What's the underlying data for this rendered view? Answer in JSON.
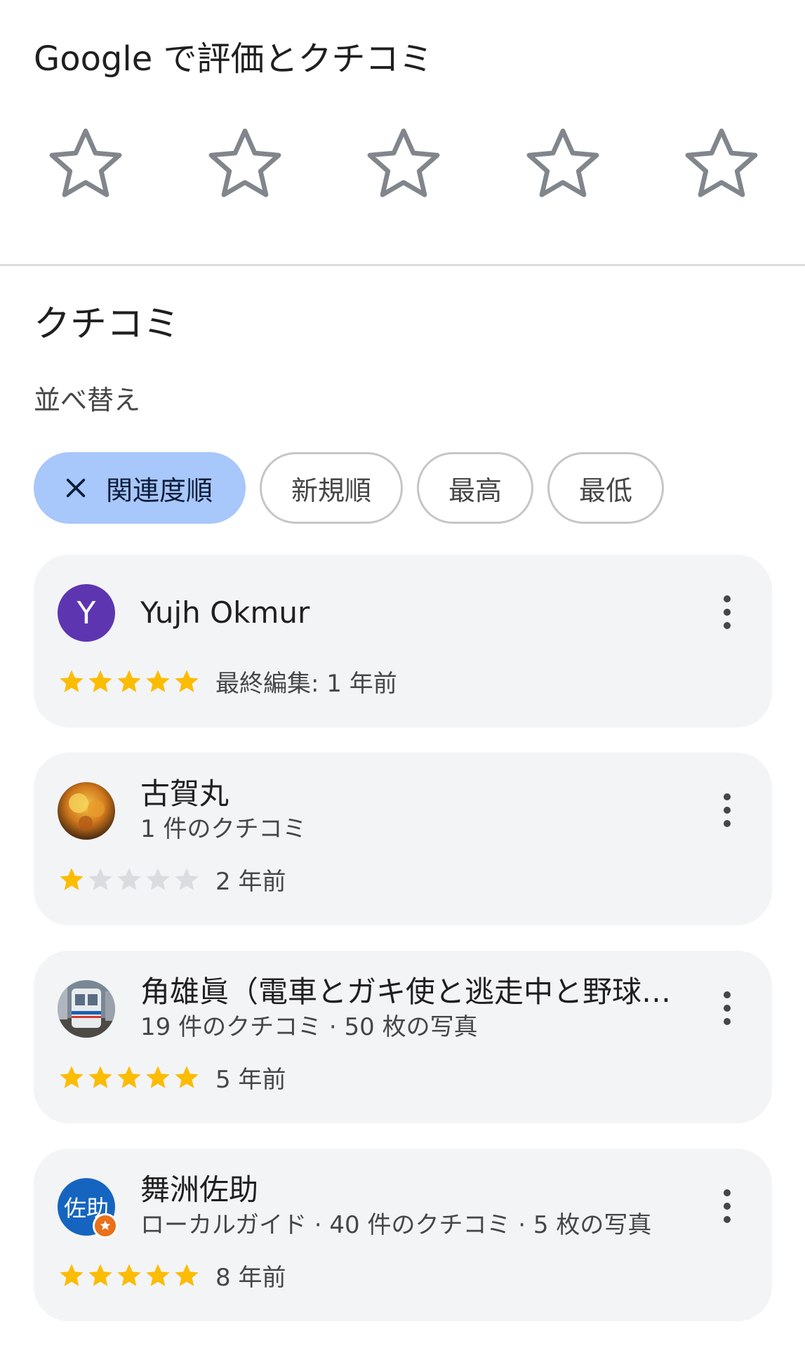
{
  "rating_section": {
    "title": "Google で評価とクチコミ",
    "stars": 5
  },
  "reviews_section": {
    "title": "クチコミ",
    "sort_label": "並べ替え",
    "chips": [
      {
        "label": "関連度順",
        "selected": true
      },
      {
        "label": "新規順",
        "selected": false
      },
      {
        "label": "最高",
        "selected": false
      },
      {
        "label": "最低",
        "selected": false
      }
    ]
  },
  "reviews": [
    {
      "avatar_letter": "Y",
      "avatar_color": "#5e35b1",
      "name": "Yujh Okmur",
      "meta": "",
      "rating": 5,
      "time": "最終編集: 1 年前"
    },
    {
      "avatar_icon": "autumn-leaves-photo",
      "name": "古賀丸",
      "meta": "1 件のクチコミ",
      "rating": 1,
      "time": "2 年前"
    },
    {
      "avatar_icon": "train-photo",
      "name": "角雄眞（電車とガキ使と逃走中と野球…",
      "meta": "19 件のクチコミ · 50 枚の写真",
      "rating": 5,
      "time": "5 年前"
    },
    {
      "avatar_icon": "local-guide-avatar",
      "avatar_text": "佐助",
      "name": "舞洲佐助",
      "meta": "ローカルガイド · 40 件のクチコミ · 5 枚の写真",
      "rating": 5,
      "time": "8 年前"
    }
  ],
  "colors": {
    "star_filled": "#fbbc04",
    "star_empty": "#dadce0",
    "chip_selected": "#a8c7fa",
    "card_bg": "#f3f4f6"
  }
}
